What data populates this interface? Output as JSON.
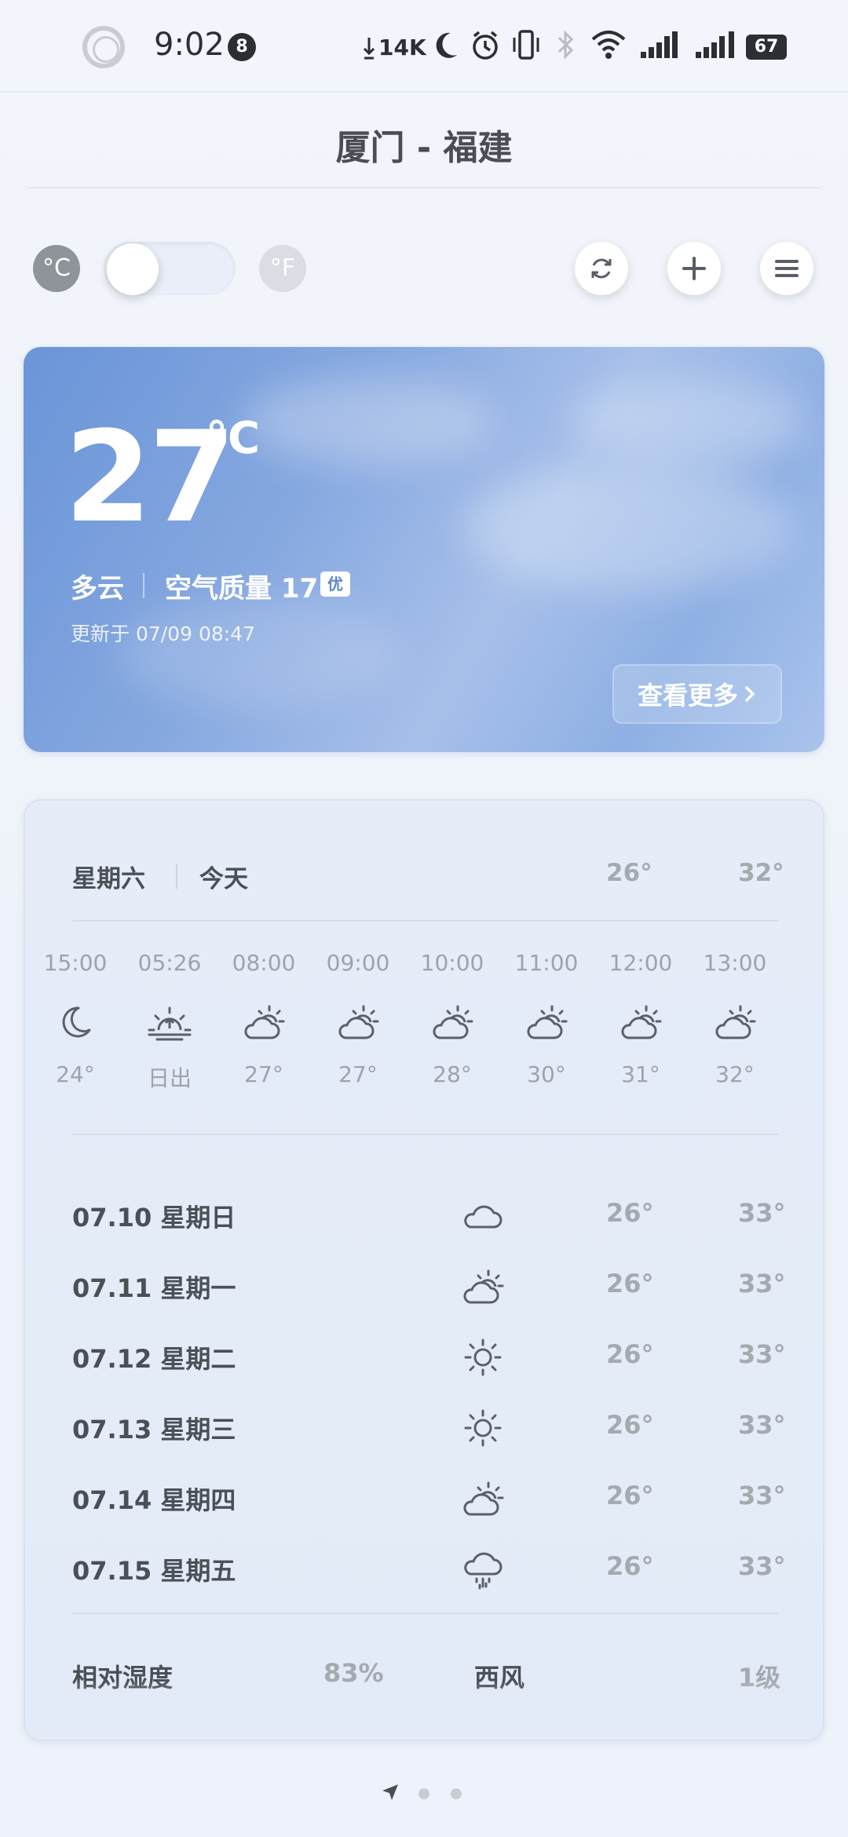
{
  "status_bar": {
    "time": "9:02",
    "notification_count": "8",
    "net_speed": "14K",
    "battery": "67"
  },
  "header": {
    "city": "厦门 - 福建"
  },
  "units": {
    "celsius": "°C",
    "fahrenheit": "°F"
  },
  "current": {
    "temperature": "27",
    "unit": "°C",
    "condition": "多云",
    "aqi_text": "空气质量 17",
    "aqi_badge": "优",
    "updated": "更新于 07/09 08:47",
    "more_label": "查看更多"
  },
  "today": {
    "day": "星期六",
    "label": "今天",
    "low": "26°",
    "high": "32°"
  },
  "hourly": [
    {
      "time": "15:00",
      "icon": "moon-icon",
      "temp": "24°"
    },
    {
      "time": "05:26",
      "icon": "sunrise-icon",
      "temp": "日出"
    },
    {
      "time": "08:00",
      "icon": "partly-cloudy-icon",
      "temp": "27°"
    },
    {
      "time": "09:00",
      "icon": "partly-cloudy-icon",
      "temp": "27°"
    },
    {
      "time": "10:00",
      "icon": "partly-cloudy-icon",
      "temp": "28°"
    },
    {
      "time": "11:00",
      "icon": "partly-cloudy-icon",
      "temp": "30°"
    },
    {
      "time": "12:00",
      "icon": "partly-cloudy-icon",
      "temp": "31°"
    },
    {
      "time": "13:00",
      "icon": "partly-cloudy-icon",
      "temp": "32°"
    }
  ],
  "daily": [
    {
      "label": "07.10 星期日",
      "icon": "cloud-icon",
      "low": "26°",
      "high": "33°"
    },
    {
      "label": "07.11 星期一",
      "icon": "partly-cloudy-icon",
      "low": "26°",
      "high": "33°"
    },
    {
      "label": "07.12 星期二",
      "icon": "sun-icon",
      "low": "26°",
      "high": "33°"
    },
    {
      "label": "07.13 星期三",
      "icon": "sun-icon",
      "low": "26°",
      "high": "33°"
    },
    {
      "label": "07.14 星期四",
      "icon": "partly-cloudy-icon",
      "low": "26°",
      "high": "33°"
    },
    {
      "label": "07.15 星期五",
      "icon": "rain-icon",
      "low": "26°",
      "high": "33°"
    }
  ],
  "details": {
    "humidity_label": "相对湿度",
    "humidity_value": "83%",
    "wind_dir": "西风",
    "wind_level": "1级"
  },
  "colors": {
    "hero_gradient_start": "#6a95d8",
    "hero_gradient_end": "#a9c3ec",
    "aqi_badge_text": "#5d86cc"
  }
}
